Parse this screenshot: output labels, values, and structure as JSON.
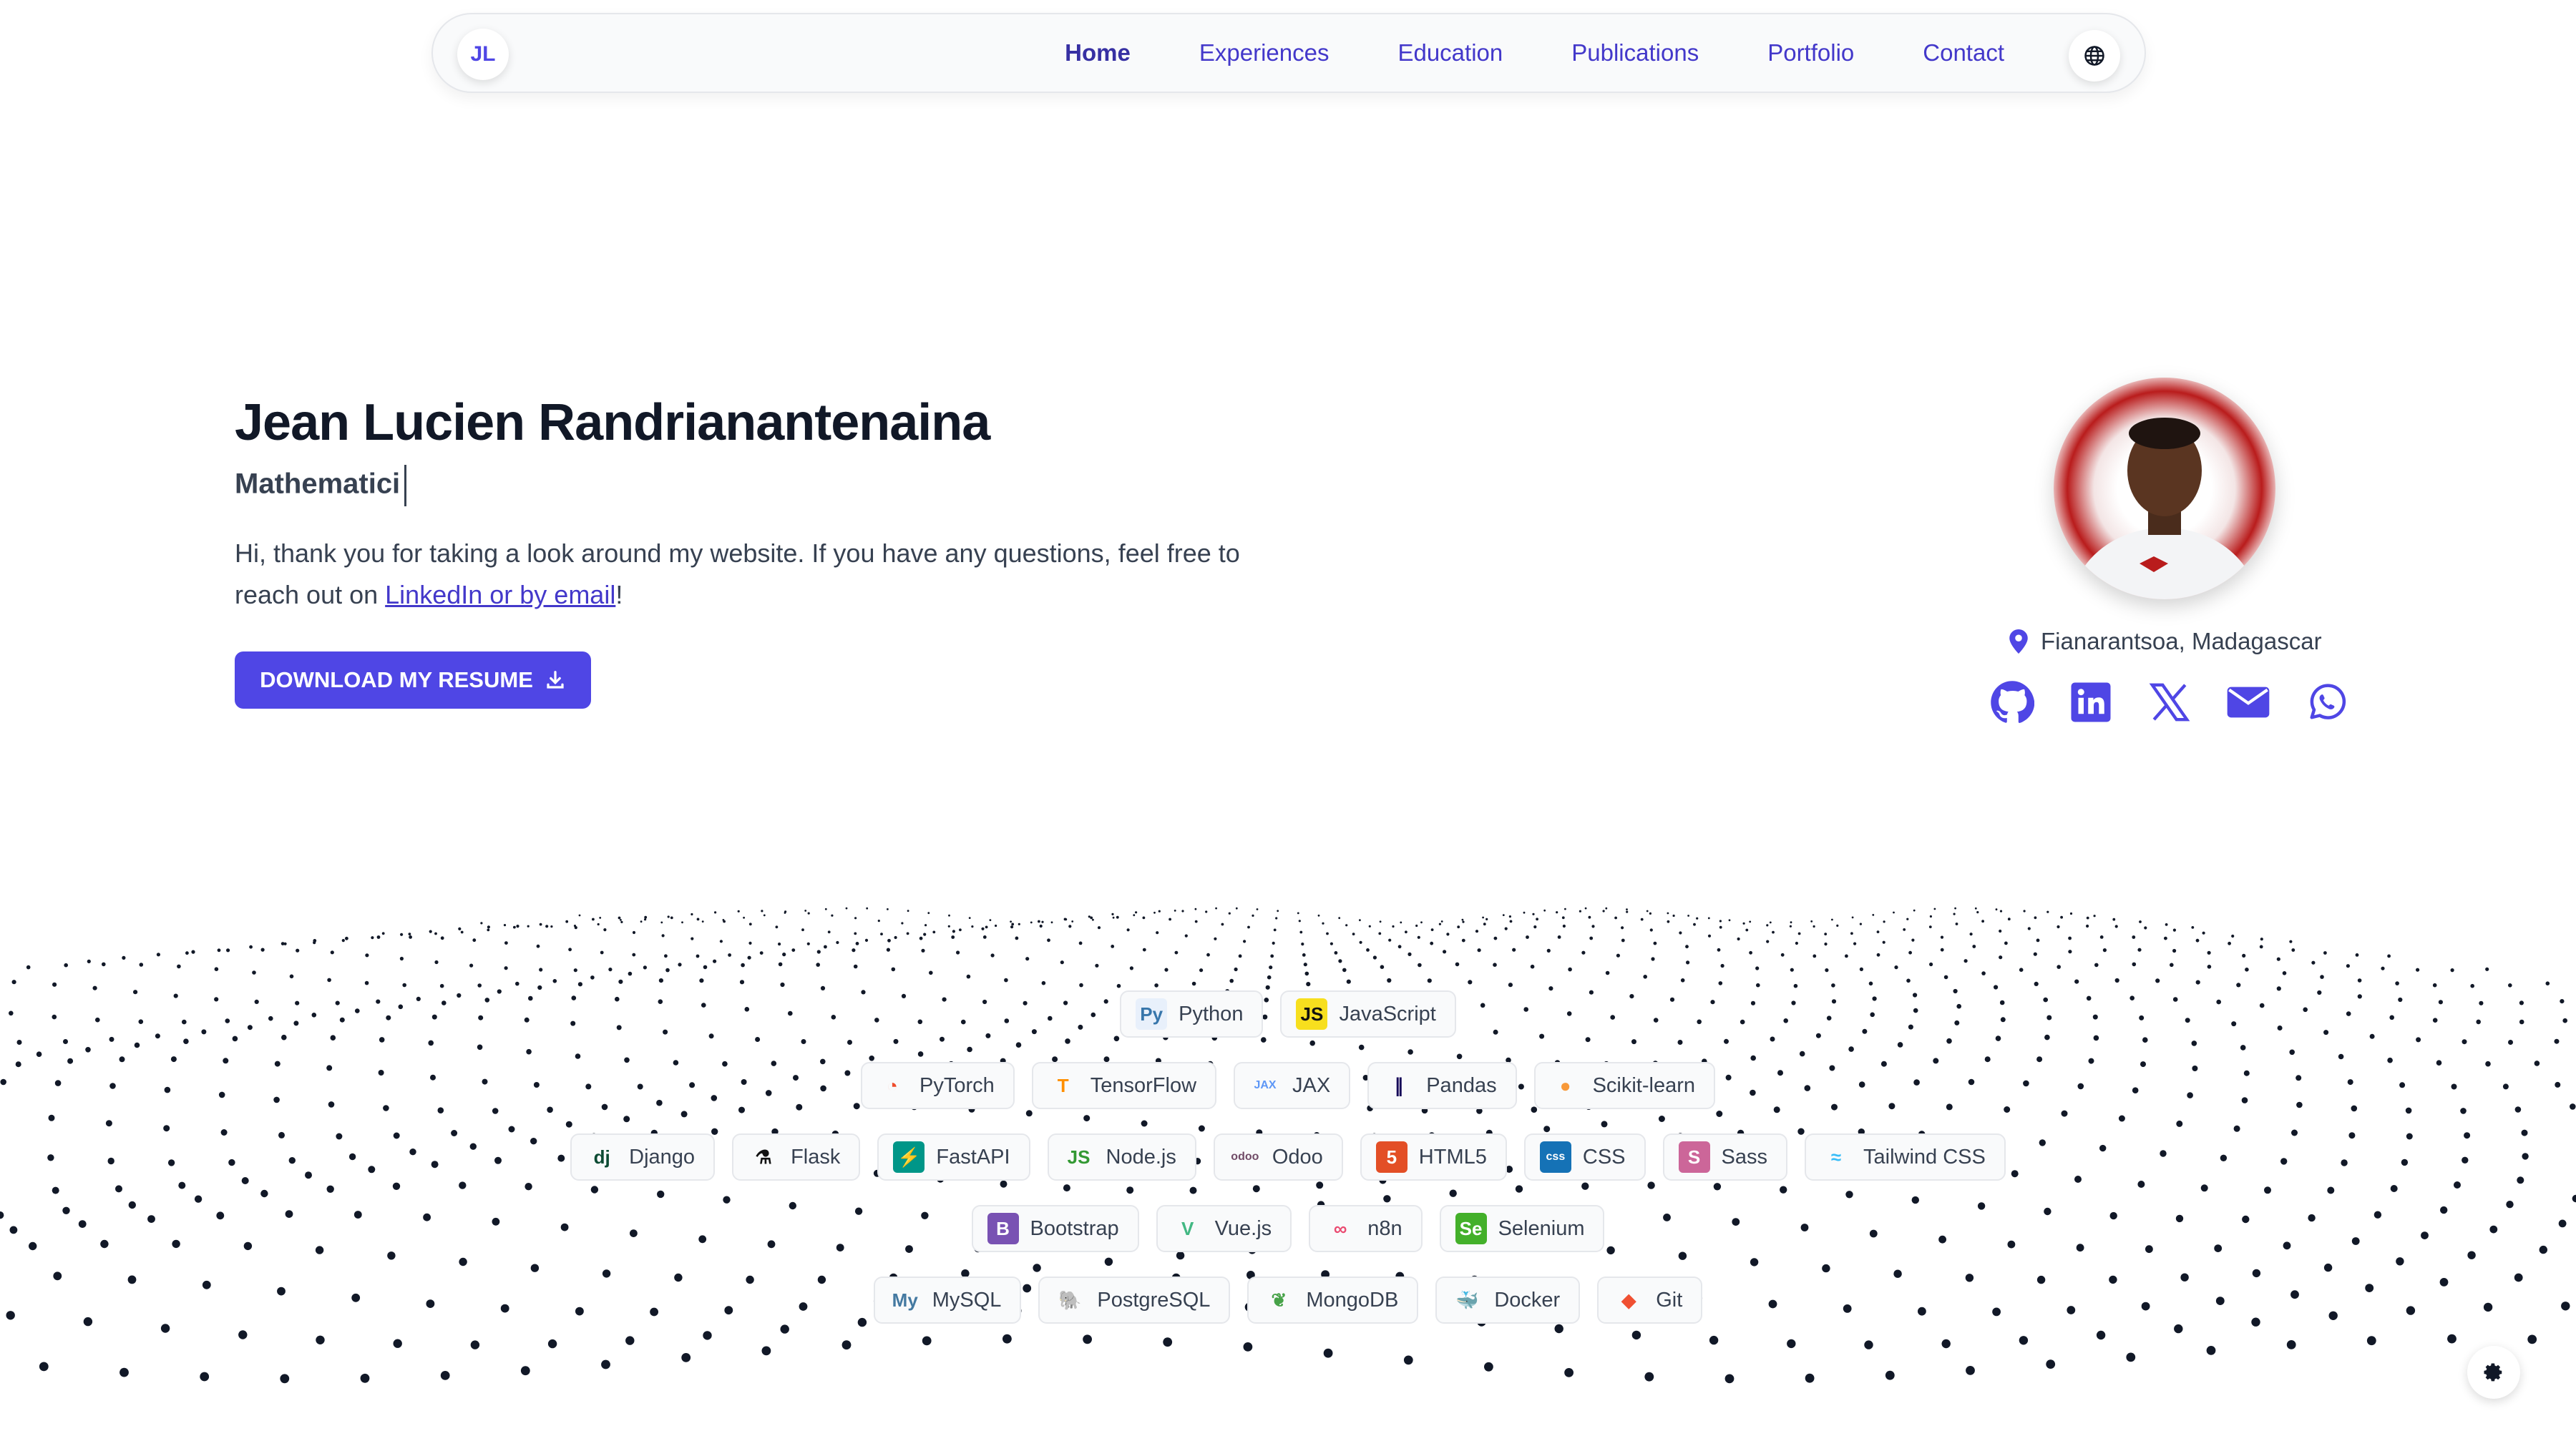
{
  "nav": {
    "logo": "JL",
    "links": [
      "Home",
      "Experiences",
      "Education",
      "Publications",
      "Portfolio",
      "Contact"
    ],
    "active": "Home",
    "language_icon": "globe-icon"
  },
  "hero": {
    "name": "Jean Lucien Randrianantenaina",
    "role_typed": "Mathematici",
    "intro_before": "Hi, thank you for taking a look around my website. If you have any questions, feel free to reach out on ",
    "intro_link": "LinkedIn or by email",
    "intro_after": "!",
    "resume_button": "DOWNLOAD MY RESUME"
  },
  "profile": {
    "location": "Fianarantsoa, Madagascar",
    "socials": [
      "github-icon",
      "linkedin-icon",
      "x-icon",
      "email-icon",
      "whatsapp-icon"
    ]
  },
  "skills": [
    [
      {
        "name": "Python",
        "icon": "python-icon"
      },
      {
        "name": "JavaScript",
        "icon": "javascript-icon"
      }
    ],
    [
      {
        "name": "PyTorch",
        "icon": "pytorch-icon"
      },
      {
        "name": "TensorFlow",
        "icon": "tensorflow-icon"
      },
      {
        "name": "JAX",
        "icon": "jax-icon"
      },
      {
        "name": "Pandas",
        "icon": "pandas-icon"
      },
      {
        "name": "Scikit-learn",
        "icon": "scikit-learn-icon"
      }
    ],
    [
      {
        "name": "Django",
        "icon": "django-icon"
      },
      {
        "name": "Flask",
        "icon": "flask-icon"
      },
      {
        "name": "FastAPI",
        "icon": "fastapi-icon"
      },
      {
        "name": "Node.js",
        "icon": "nodejs-icon"
      },
      {
        "name": "Odoo",
        "icon": "odoo-icon"
      },
      {
        "name": "HTML5",
        "icon": "html5-icon"
      },
      {
        "name": "CSS",
        "icon": "css-icon"
      },
      {
        "name": "Sass",
        "icon": "sass-icon"
      },
      {
        "name": "Tailwind CSS",
        "icon": "tailwind-icon"
      }
    ],
    [
      {
        "name": "Bootstrap",
        "icon": "bootstrap-icon"
      },
      {
        "name": "Vue.js",
        "icon": "vuejs-icon"
      },
      {
        "name": "n8n",
        "icon": "n8n-icon"
      },
      {
        "name": "Selenium",
        "icon": "selenium-icon"
      }
    ],
    [
      {
        "name": "MySQL",
        "icon": "mysql-icon"
      },
      {
        "name": "PostgreSQL",
        "icon": "postgresql-icon"
      },
      {
        "name": "MongoDB",
        "icon": "mongodb-icon"
      },
      {
        "name": "Docker",
        "icon": "docker-icon"
      },
      {
        "name": "Git",
        "icon": "git-icon"
      }
    ]
  ],
  "theme_toggle_icon": "settings-icon",
  "colors": {
    "accent": "#4f46e5",
    "text": "#111827"
  }
}
